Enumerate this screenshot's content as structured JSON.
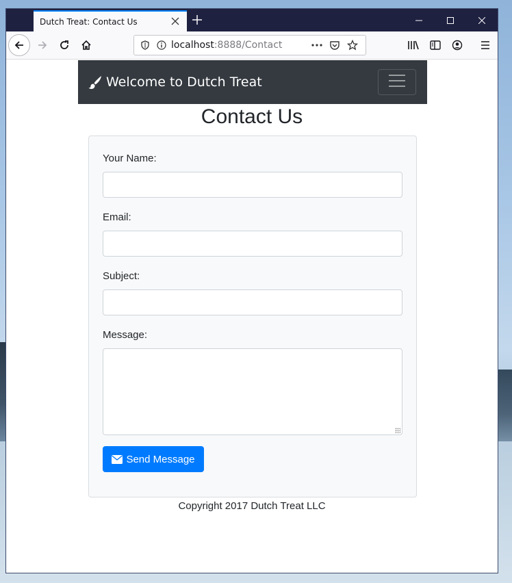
{
  "browser": {
    "tab_title": "Dutch Treat: Contact Us",
    "url_host": "localhost",
    "url_rest": ":8888/Contact",
    "accent_color": "#0a84ff"
  },
  "navbar": {
    "brand": "Welcome to Dutch Treat",
    "brand_icon": "paint-brush-icon",
    "toggler_icon": "hamburger-icon",
    "bg_color": "#343a40"
  },
  "page": {
    "title": "Contact Us"
  },
  "form": {
    "name_label": "Your Name:",
    "name_value": "",
    "email_label": "Email:",
    "email_value": "",
    "subject_label": "Subject:",
    "subject_value": "",
    "message_label": "Message:",
    "message_value": "",
    "submit_label": "Send Message",
    "submit_icon": "envelope-icon",
    "submit_color": "#007bff"
  },
  "footer": {
    "text": "Copyright 2017 Dutch Treat LLC"
  }
}
